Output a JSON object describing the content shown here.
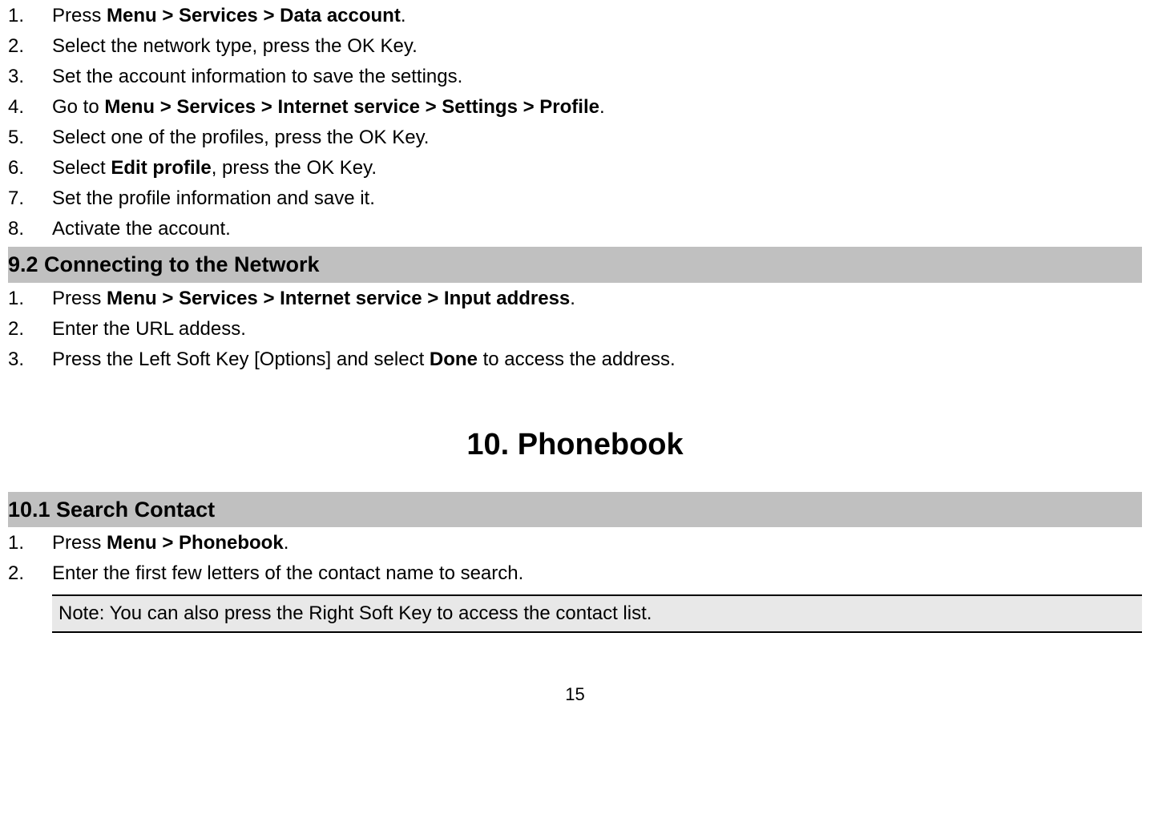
{
  "list1": {
    "item1": {
      "num": "1.",
      "prefix": "Press ",
      "bold": "Menu > Services > Data account",
      "suffix": "."
    },
    "item2": {
      "num": "2.",
      "text": "Select the network type, press the OK Key."
    },
    "item3": {
      "num": "3.",
      "text": "Set the account information to save the settings."
    },
    "item4": {
      "num": "4.",
      "prefix": "Go to ",
      "bold": "Menu > Services > Internet service > Settings > Profile",
      "suffix": "."
    },
    "item5": {
      "num": "5.",
      "text": "Select one of the profiles, press the OK Key."
    },
    "item6": {
      "num": "6.",
      "prefix": "Select ",
      "bold": "Edit profile",
      "suffix": ", press the OK Key."
    },
    "item7": {
      "num": "7.",
      "text": "Set the profile information and save it."
    },
    "item8": {
      "num": "8.",
      "text": "Activate the account."
    }
  },
  "section92": "9.2  Connecting to the Network",
  "list2": {
    "item1": {
      "num": "1.",
      "prefix": "Press ",
      "bold": "Menu > Services > Internet service > Input address",
      "suffix": "."
    },
    "item2": {
      "num": "2.",
      "text": "Enter the URL addess."
    },
    "item3": {
      "num": "3.",
      "prefix": "Press the Left Soft Key [Options] and select ",
      "bold": "Done",
      "suffix": " to access the address."
    }
  },
  "chapter10": "10.  Phonebook",
  "section101": "10.1 Search Contact",
  "list3": {
    "item1": {
      "num": "1.",
      "prefix": " Press ",
      "bold": "Menu > Phonebook",
      "suffix": "."
    },
    "item2": {
      "num": "2.",
      "text": "Enter the first few letters of the contact name to search."
    }
  },
  "note": "Note: You can also press the Right Soft Key to access the contact list.",
  "pageNumber": "15"
}
